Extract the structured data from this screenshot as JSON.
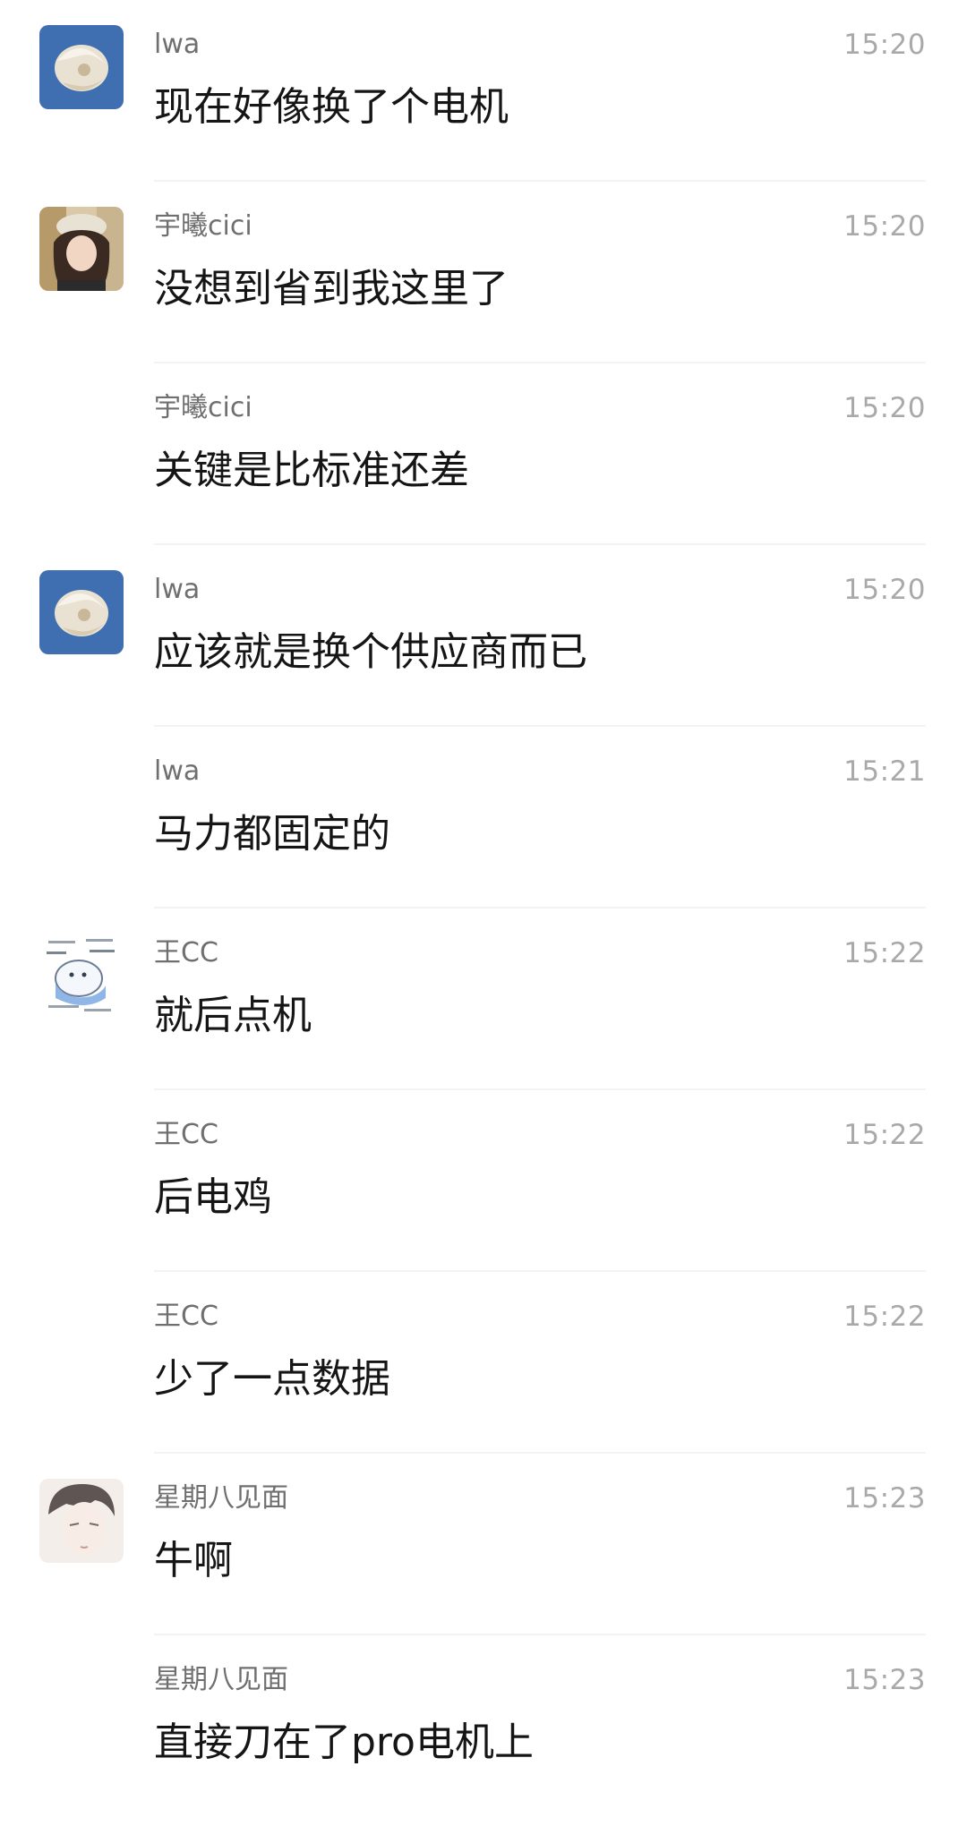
{
  "messages": [
    {
      "sender": "lwa",
      "time": "15:20",
      "text": "现在好像换了个电机",
      "avatar": "lwa-avatar"
    },
    {
      "sender": "宇曦cici",
      "time": "15:20",
      "text": "没想到省到我这里了",
      "avatar": "cici-avatar"
    },
    {
      "sender": "宇曦cici",
      "time": "15:20",
      "text": "关键是比标准还差",
      "avatar": ""
    },
    {
      "sender": "lwa",
      "time": "15:20",
      "text": "应该就是换个供应商而已",
      "avatar": "lwa-avatar"
    },
    {
      "sender": "lwa",
      "time": "15:21",
      "text": "马力都固定的",
      "avatar": ""
    },
    {
      "sender": "王CC",
      "time": "15:22",
      "text": "就后点机",
      "avatar": "wangcc-avatar"
    },
    {
      "sender": "王CC",
      "time": "15:22",
      "text": "后电鸡",
      "avatar": ""
    },
    {
      "sender": "王CC",
      "time": "15:22",
      "text": "少了一点数据",
      "avatar": ""
    },
    {
      "sender": "星期八见面",
      "time": "15:23",
      "text": "牛啊",
      "avatar": "xingqiba-avatar"
    },
    {
      "sender": "星期八见面",
      "time": "15:23",
      "text": "直接刀在了pro电机上",
      "avatar": ""
    }
  ],
  "colors": {
    "background": "#ffffff",
    "sender_name": "#6f6f6f",
    "timestamp": "#a9a9a9",
    "message_text": "#151515",
    "divider": "#f3f3f3"
  }
}
